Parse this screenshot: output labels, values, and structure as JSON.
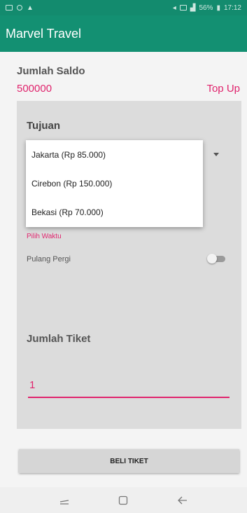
{
  "status_bar": {
    "battery": "56%",
    "time": "17:12"
  },
  "app_bar": {
    "title": "Marvel Travel"
  },
  "saldo": {
    "label": "Jumlah Saldo",
    "value": "500000",
    "topup_label": "Top Up"
  },
  "tujuan": {
    "label": "Tujuan",
    "options": [
      "Jakarta (Rp 85.000)",
      "Cirebon (Rp 150.000)",
      "Bekasi (Rp 70.000)"
    ]
  },
  "waktu": {
    "label": "Pilih Waktu"
  },
  "pulang_pergi": {
    "label": "Pulang Pergi",
    "checked": false
  },
  "tiket": {
    "label": "Jumlah Tiket",
    "value": "1"
  },
  "beli_button": {
    "label": "BELI TIKET"
  },
  "colors": {
    "primary": "#139072",
    "accent": "#e0246d"
  },
  "nav_icons": [
    "recents-icon",
    "home-icon",
    "back-icon"
  ]
}
